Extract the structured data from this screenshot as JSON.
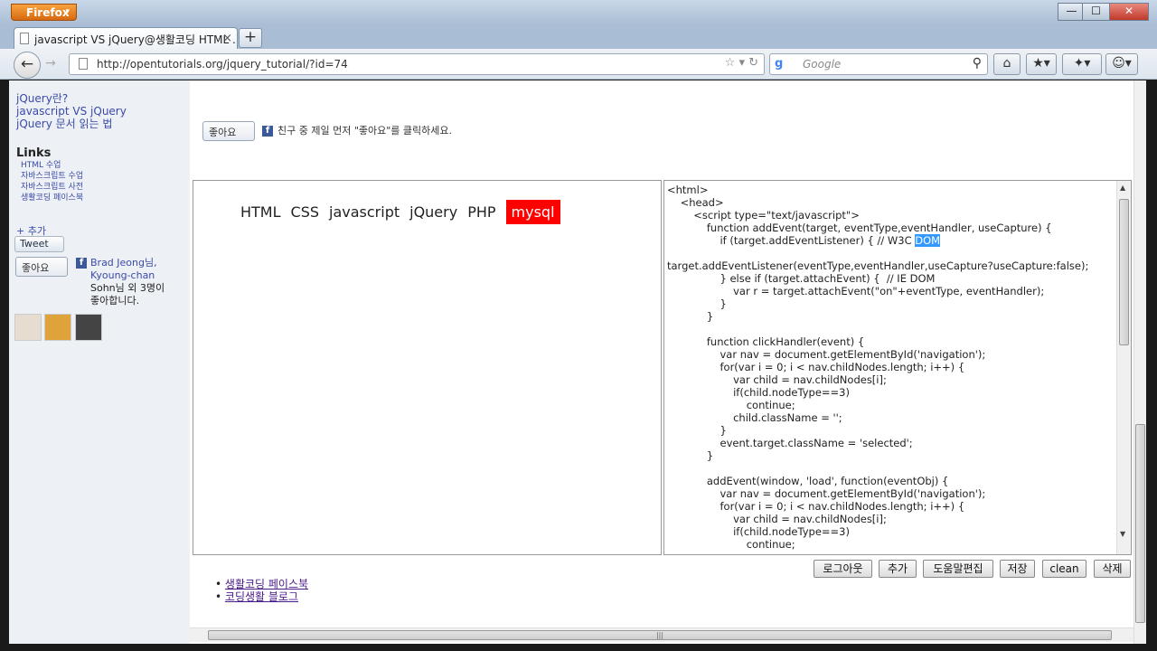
{
  "browser": {
    "menu_label": "Firefox",
    "menu_arrow": "▾",
    "tab_title": "javascript VS jQuery@생활코딩 HTML ...",
    "tab_close": "×",
    "newtab_label": "+",
    "back_label": "←",
    "forward_label": "→",
    "url": "http://opentutorials.org/jquery_tutorial/?id=74",
    "url_tools": "☆ ▾ ↻",
    "search_engine_icon": "g",
    "search_placeholder": "Google",
    "search_icon": "⚲",
    "home_label": "⌂",
    "bookmarks_label": "★▾",
    "addon_label": "✦▾",
    "monkey_label": "☺▾",
    "minimize_label": "—",
    "maximize_label": "☐",
    "close_label": "✕"
  },
  "sidebar": {
    "intro_links": [
      "jQuery란?",
      "javascript VS jQuery",
      "jQuery 문서 읽는 법"
    ],
    "links_title": "Links",
    "links": [
      "HTML 수업",
      "자바스크립트 수업",
      "자바스크립트 사전",
      "생활코딩 페이스북"
    ],
    "add_label": "+ 추가",
    "tweet_label": "Tweet",
    "like_label": "좋아요",
    "fb_icon": "f",
    "fb_friends_text": [
      "Brad Jeong님,",
      "Kyoung-chan",
      "Sohn님 외 3명이",
      "좋아합니다."
    ]
  },
  "content": {
    "like_label": "좋아요",
    "fb_icon": "f",
    "like_prompt": "친구 중 제일 먼저 \"좋아요\"를 클릭하세요.",
    "nav_items": [
      "HTML",
      "CSS",
      "javascript",
      "jQuery",
      "PHP",
      "mysql"
    ],
    "selected_nav": "mysql",
    "code_lines": [
      "<html>",
      "    <head>",
      "        <script type=\"text/javascript\">",
      "            function addEvent(target, eventType,eventHandler, useCapture) {",
      "                if (target.addEventListener) { // W3C ",
      "",
      "target.addEventListener(eventType,eventHandler,useCapture?useCapture:false);",
      "                } else if (target.attachEvent) {  // IE DOM",
      "                    var r = target.attachEvent(\"on\"+eventType, eventHandler);",
      "                }",
      "            }",
      "",
      "            function clickHandler(event) {",
      "                var nav = document.getElementById('navigation');",
      "                for(var i = 0; i < nav.childNodes.length; i++) {",
      "                    var child = nav.childNodes[i];",
      "                    if(child.nodeType==3)",
      "                        continue;",
      "                    child.className = '';",
      "                }",
      "                event.target.className = 'selected';",
      "            }",
      "",
      "            addEvent(window, 'load', function(eventObj) {",
      "                var nav = document.getElementById('navigation');",
      "                for(var i = 0; i < nav.childNodes.length; i++) {",
      "                    var child = nav.childNodes[i];",
      "                    if(child.nodeType==3)",
      "                        continue;"
    ],
    "highlighted_word": "DOM",
    "actions": [
      "로그아웃",
      "추가",
      "도움말편집",
      "저장",
      "clean",
      "삭제"
    ],
    "bullets": [
      "생활코딩 페이스북",
      "코딩생활 블로그"
    ],
    "hscroll_grip": "|||"
  }
}
